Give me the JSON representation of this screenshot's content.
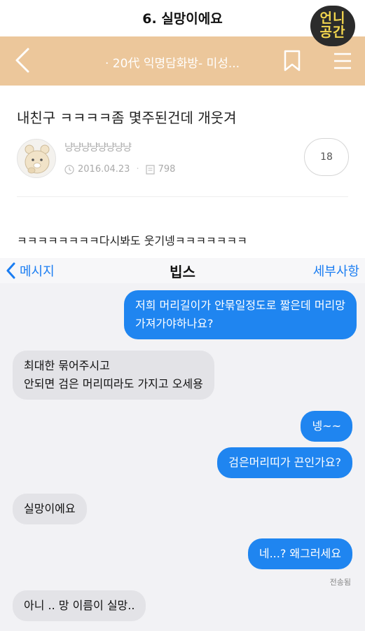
{
  "caption": {
    "title": "6. 실망이에요"
  },
  "logo": {
    "line1": "언니",
    "line2": "공간"
  },
  "appbar": {
    "title": "· 20代 익명담화방- 미성..."
  },
  "post": {
    "title": "내친구 ㅋㅋㅋㅋ좀 몇주된건데 개웃겨",
    "author": "냥냥냥냥냥냥냥냥",
    "date": "2016.04.23",
    "views": "798",
    "comments": "18",
    "body": "ㅋㅋㅋㅋㅋㅋㅋㅋ다시봐도 웃기넹ㅋㅋㅋㅋㅋㅋㅋ"
  },
  "chat": {
    "back_label": "메시지",
    "contact_name": "빕스",
    "details_label": "세부사항",
    "delivered_label": "전송됨",
    "messages": [
      {
        "from": "me",
        "lines": [
          "저희 머리길이가 안묶일정도로 짧은데 머리망",
          "가져가야하나요?"
        ]
      },
      {
        "from": "them",
        "lines": [
          "최대한 묶어주시고",
          "안되면 검은 머리띠라도 가지고 오세용"
        ]
      },
      {
        "from": "me",
        "lines": [
          "넹~~"
        ]
      },
      {
        "from": "me",
        "lines": [
          "검은머리띠가 끈인가요?"
        ]
      },
      {
        "from": "them",
        "lines": [
          "실망이에요"
        ]
      },
      {
        "from": "me",
        "lines": [
          "네...? 왜그러세요"
        ]
      },
      {
        "from": "them",
        "lines": [
          "아니 .. 망 이름이 실망.."
        ]
      }
    ]
  },
  "colors": {
    "appbar": "#ecc79b",
    "sent_bubble": "#1f85f0",
    "received_bubble": "#e3e3e7",
    "ios_blue": "#1a7df2"
  }
}
